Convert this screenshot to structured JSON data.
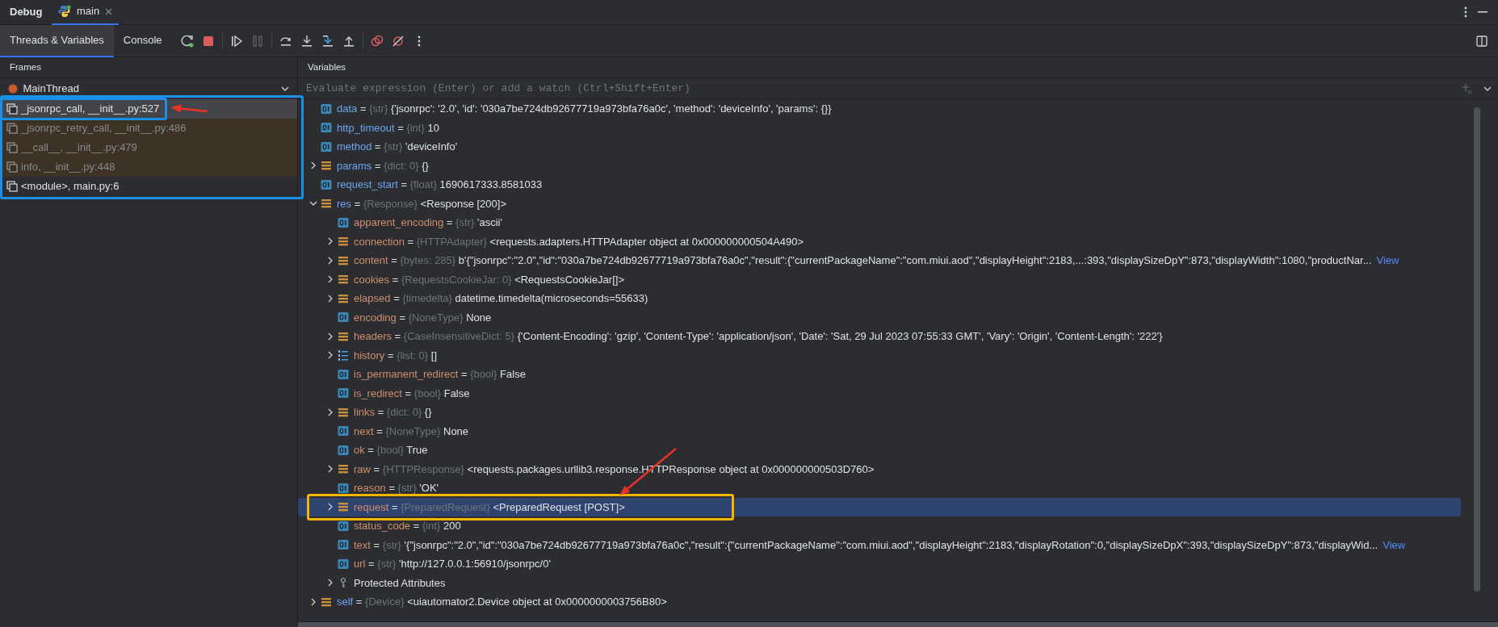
{
  "tool_window": {
    "title": "Debug",
    "tabs": [
      {
        "label": "main",
        "selected": true
      }
    ]
  },
  "view_tabs": [
    {
      "label": "Threads & Variables",
      "selected": true
    },
    {
      "label": "Console",
      "selected": false
    }
  ],
  "toolbar": [
    {
      "kind": "rerun",
      "disabled": false
    },
    {
      "kind": "stop",
      "disabled": false
    },
    {
      "kind": "separator"
    },
    {
      "kind": "resume",
      "disabled": false
    },
    {
      "kind": "pause",
      "disabled": true
    },
    {
      "kind": "separator"
    },
    {
      "kind": "step-over",
      "disabled": false
    },
    {
      "kind": "step-into",
      "disabled": false
    },
    {
      "kind": "step-into-my-code",
      "disabled": false
    },
    {
      "kind": "step-out",
      "disabled": false
    },
    {
      "kind": "separator"
    },
    {
      "kind": "breakpoints",
      "disabled": false
    },
    {
      "kind": "mute-breakpoints",
      "disabled": false
    },
    {
      "kind": "more",
      "disabled": false
    }
  ],
  "frames_panel": {
    "title": "Frames",
    "thread": "MainThread"
  },
  "frames": [
    {
      "label": "_jsonrpc_call, __init__.py:527",
      "selected": true,
      "library": false
    },
    {
      "label": "_jsonrpc_retry_call, __init__.py:486",
      "selected": false,
      "library": true
    },
    {
      "label": "__call__, __init__.py:479",
      "selected": false,
      "library": true
    },
    {
      "label": "info, __init__.py:448",
      "selected": false,
      "library": true
    },
    {
      "label": "<module>, main.py:6",
      "selected": false,
      "library": false
    }
  ],
  "variables_panel": {
    "title": "Variables",
    "placeholder": "Evaluate expression (Enter) or add a watch (Ctrl+Shift+Enter)"
  },
  "variables": [
    {
      "kind": "field",
      "name": "data",
      "op": "=",
      "type": "{str}",
      "value": "{'jsonrpc': '2.0', 'id': '030a7be724db92677719a973bfa76a0c', 'method': 'deviceInfo', 'params': {}}",
      "expanded": false,
      "selected": false
    },
    {
      "kind": "field",
      "name": "http_timeout",
      "op": "=",
      "type": "{int}",
      "value": "10",
      "expanded": false,
      "selected": false
    },
    {
      "kind": "field",
      "name": "method",
      "op": "=",
      "type": "{str}",
      "value": "'deviceInfo'",
      "expanded": false,
      "selected": false
    },
    {
      "kind": "object",
      "name": "params",
      "op": "=",
      "type": "{dict: 0}",
      "value": "{}",
      "expanded": false,
      "selected": false
    },
    {
      "kind": "field",
      "name": "request_start",
      "op": "=",
      "type": "{float}",
      "value": "1690617333.8581033",
      "expanded": false,
      "selected": false
    },
    {
      "kind": "object",
      "name": "res",
      "op": "=",
      "type": "{Response}",
      "value": "<Response [200]>",
      "expanded": true,
      "selected": false,
      "children": [
        {
          "kind": "field",
          "name": "apparent_encoding",
          "op": "=",
          "type": "{str}",
          "value": "'ascii'",
          "expanded": false,
          "selected": false
        },
        {
          "kind": "object",
          "name": "connection",
          "op": "=",
          "type": "{HTTPAdapter}",
          "value": "<requests.adapters.HTTPAdapter object at 0x000000000504A490>",
          "expanded": false,
          "selected": false
        },
        {
          "kind": "object",
          "name": "content",
          "op": "=",
          "type": "{bytes: 285}",
          "value": "b'{\"jsonrpc\":\"2.0\",\"id\":\"030a7be724db92677719a973bfa76a0c\",\"result\":{\"currentPackageName\":\"com.miui.aod\",\"displayHeight\":2183,...:393,\"displaySizeDpY\":873,\"displayWidth\":1080,\"productNar...",
          "link": "View",
          "expanded": false,
          "selected": false
        },
        {
          "kind": "object",
          "name": "cookies",
          "op": "=",
          "type": "{RequestsCookieJar: 0}",
          "value": "<RequestsCookieJar[]>",
          "expanded": false,
          "selected": false
        },
        {
          "kind": "object",
          "name": "elapsed",
          "op": "=",
          "type": "{timedelta}",
          "value": "datetime.timedelta(microseconds=55633)",
          "expanded": false,
          "selected": false
        },
        {
          "kind": "field",
          "name": "encoding",
          "op": "=",
          "type": "{NoneType}",
          "value": "None",
          "expanded": false,
          "selected": false
        },
        {
          "kind": "object",
          "name": "headers",
          "op": "=",
          "type": "{CaseInsensitiveDict: 5}",
          "value": "{'Content-Encoding': 'gzip', 'Content-Type': 'application/json', 'Date': 'Sat, 29 Jul 2023 07:55:33 GMT', 'Vary': 'Origin', 'Content-Length': '222'}",
          "expanded": false,
          "selected": false
        },
        {
          "kind": "list",
          "name": "history",
          "op": "=",
          "type": "{list: 0}",
          "value": "[]",
          "expanded": false,
          "selected": false
        },
        {
          "kind": "field",
          "name": "is_permanent_redirect",
          "op": "=",
          "type": "{bool}",
          "value": "False",
          "expanded": false,
          "selected": false
        },
        {
          "kind": "field",
          "name": "is_redirect",
          "op": "=",
          "type": "{bool}",
          "value": "False",
          "expanded": false,
          "selected": false
        },
        {
          "kind": "object",
          "name": "links",
          "op": "=",
          "type": "{dict: 0}",
          "value": "{}",
          "expanded": false,
          "selected": false
        },
        {
          "kind": "field",
          "name": "next",
          "op": "=",
          "type": "{NoneType}",
          "value": "None",
          "expanded": false,
          "selected": false
        },
        {
          "kind": "field",
          "name": "ok",
          "op": "=",
          "type": "{bool}",
          "value": "True",
          "expanded": false,
          "selected": false
        },
        {
          "kind": "object",
          "name": "raw",
          "op": "=",
          "type": "{HTTPResponse}",
          "value": "<requests.packages.urllib3.response.HTTPResponse object at 0x000000000503D760>",
          "expanded": false,
          "selected": false
        },
        {
          "kind": "field",
          "name": "reason",
          "op": "=",
          "type": "{str}",
          "value": "'OK'",
          "expanded": false,
          "selected": false
        },
        {
          "kind": "object",
          "name": "request",
          "op": "=",
          "type": "{PreparedRequest}",
          "value": "<PreparedRequest [POST]>",
          "expanded": false,
          "selected": true
        },
        {
          "kind": "field",
          "name": "status_code",
          "op": "=",
          "type": "{int}",
          "value": "200",
          "expanded": false,
          "selected": false
        },
        {
          "kind": "field",
          "name": "text",
          "op": "=",
          "type": "{str}",
          "value": "'{\"jsonrpc\":\"2.0\",\"id\":\"030a7be724db92677719a973bfa76a0c\",\"result\":{\"currentPackageName\":\"com.miui.aod\",\"displayHeight\":2183,\"displayRotation\":0,\"displaySizeDpX\":393,\"displaySizeDpY\":873,\"displayWid...",
          "link": "View",
          "expanded": false,
          "selected": false
        },
        {
          "kind": "field",
          "name": "url",
          "op": "=",
          "type": "{str}",
          "value": "'http://127.0.0.1:56910/jsonrpc/0'",
          "expanded": false,
          "selected": false
        },
        {
          "kind": "protected",
          "name": "Protected Attributes",
          "expanded": false,
          "selected": false
        }
      ]
    },
    {
      "kind": "object",
      "name": "self",
      "op": "=",
      "type": "{Device}",
      "value": "<uiautomator2.Device object at 0x0000000003756B80>",
      "expanded": false,
      "selected": false
    }
  ]
}
